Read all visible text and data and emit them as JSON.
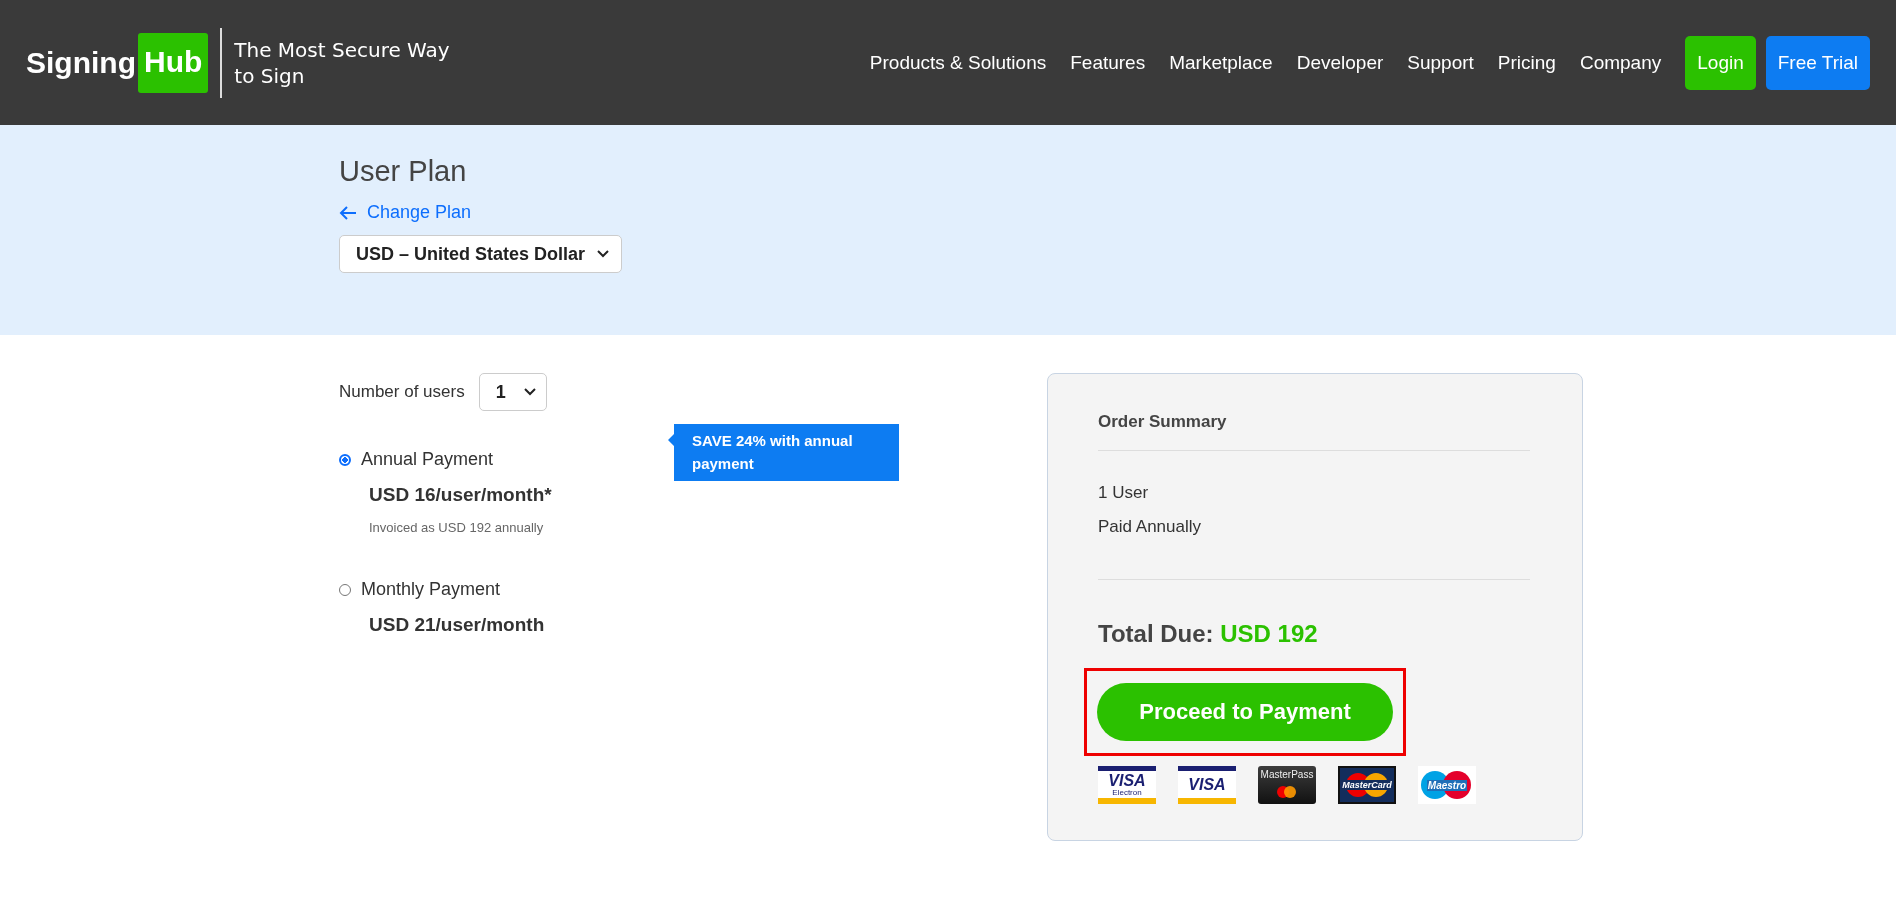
{
  "header": {
    "logo": {
      "word": "Signing",
      "badge": "Hub"
    },
    "tagline": "The Most Secure Way to Sign",
    "nav": [
      "Products & Solutions",
      "Features",
      "Marketplace",
      "Developer",
      "Support",
      "Pricing",
      "Company"
    ],
    "buttons": [
      {
        "label": "Login",
        "kind": "login"
      },
      {
        "label": "Free Trial",
        "kind": "trial"
      }
    ]
  },
  "plan_header": {
    "title": "User Plan",
    "back_link": "Change Plan",
    "currency": "USD – United States Dollar"
  },
  "users": {
    "label": "Number of users",
    "value": "1"
  },
  "options": [
    {
      "name": "Annual Payment",
      "price": "USD 16/user/month*",
      "note": "Invoiced as USD 192 annually",
      "selected": true,
      "badge": "SAVE 24% with annual payment"
    },
    {
      "name": "Monthly Payment",
      "price": "USD 21/user/month",
      "selected": false
    }
  ],
  "summary": {
    "title": "Order Summary",
    "lines": [
      "1 User",
      "Paid Annually"
    ],
    "total_label": "Total Due:",
    "total_value": "USD 192",
    "button": {
      "label": "Proceed to Payment",
      "highlighted": true
    },
    "cards": [
      {
        "kind": "visa",
        "text": "VISA",
        "sub": "Electron"
      },
      {
        "kind": "visa",
        "text": "VISA"
      },
      {
        "kind": "masterpass",
        "text": "MasterPass"
      },
      {
        "kind": "mastercard",
        "text": "MasterCard"
      },
      {
        "kind": "maestro",
        "text": "Maestro"
      }
    ]
  }
}
